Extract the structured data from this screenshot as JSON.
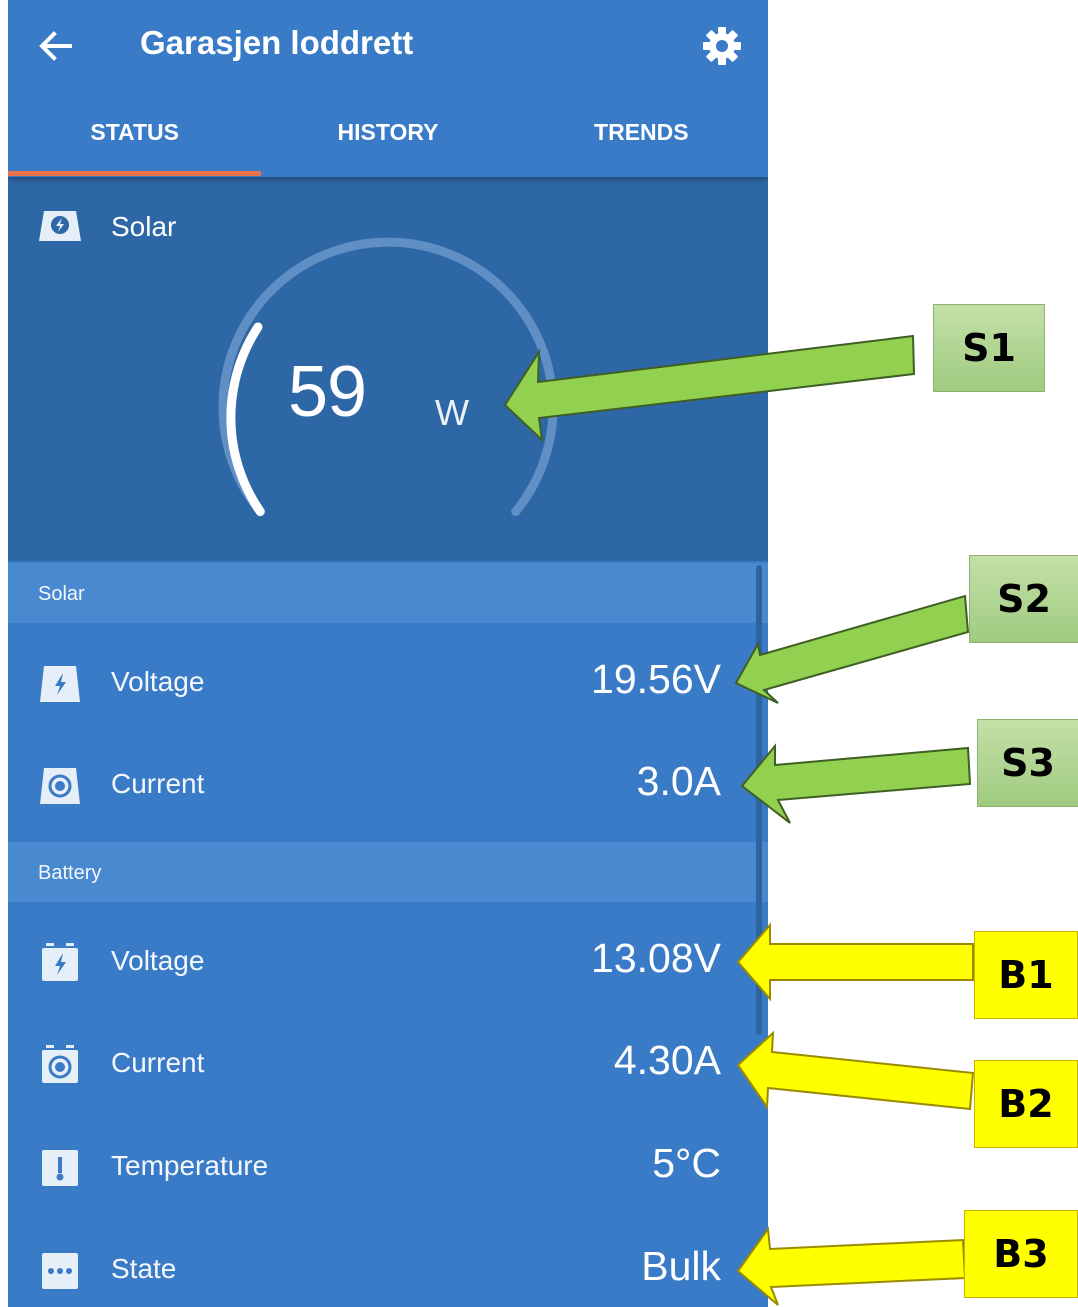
{
  "appbar": {
    "title": "Garasjen loddrett",
    "back_icon": "arrow-left-icon",
    "settings_icon": "gear-icon"
  },
  "tabs": [
    {
      "label": "STATUS",
      "active": true
    },
    {
      "label": "HISTORY",
      "active": false
    },
    {
      "label": "TRENDS",
      "active": false
    }
  ],
  "gauge": {
    "title": "Solar",
    "value": "59",
    "unit": "W",
    "icon": "solar-panel-icon"
  },
  "solar_section": {
    "header": "Solar",
    "rows": [
      {
        "label": "Voltage",
        "value": "19.56V",
        "icon": "bolt-icon"
      },
      {
        "label": "Current",
        "value": "3.0A",
        "icon": "current-icon"
      }
    ]
  },
  "battery_section": {
    "header": "Battery",
    "rows": [
      {
        "label": "Voltage",
        "value": "13.08V",
        "icon": "battery-bolt-icon"
      },
      {
        "label": "Current",
        "value": "4.30A",
        "icon": "battery-current-icon"
      },
      {
        "label": "Temperature",
        "value": "5°C",
        "icon": "thermometer-icon"
      },
      {
        "label": "State",
        "value": "Bulk",
        "icon": "more-icon"
      }
    ]
  },
  "callouts": [
    {
      "label": "S1",
      "color": "#9fcb80"
    },
    {
      "label": "S2",
      "color": "#9fcb80"
    },
    {
      "label": "S3",
      "color": "#9fcb80"
    },
    {
      "label": "B1",
      "color": "#ffff00"
    },
    {
      "label": "B2",
      "color": "#ffff00"
    },
    {
      "label": "B3",
      "color": "#ffff00"
    }
  ],
  "colors": {
    "primary": "#3a7bc8",
    "gauge_bg": "#2e67a6",
    "section_header": "#4a8ad0",
    "tab_indicator": "#e8734a"
  }
}
